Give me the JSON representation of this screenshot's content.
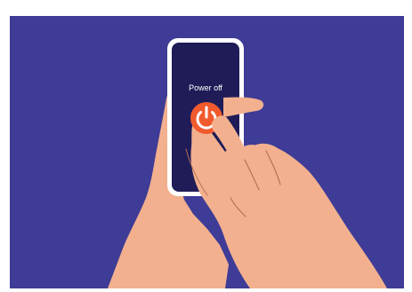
{
  "screen": {
    "label": "Power off"
  },
  "colors": {
    "background": "#3e3c96",
    "phone_frame": "#ffffff",
    "phone_screen": "#1f1c58",
    "power_button": "#f05a2d",
    "skin": "#f3b08f",
    "skin_line": "#b77055"
  },
  "icons": {
    "power": "power-icon"
  }
}
